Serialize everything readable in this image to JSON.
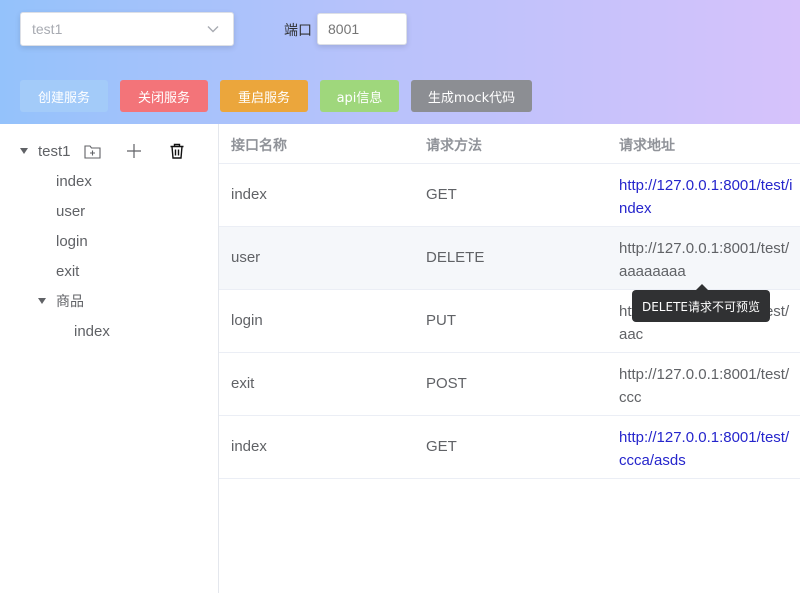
{
  "header": {
    "project_select": {
      "value": "test1",
      "icon": "chevron-down-icon"
    },
    "port_label": "端口",
    "port_input": {
      "placeholder": "8001",
      "value": ""
    },
    "buttons": {
      "create": "创建服务",
      "close": "关闭服务",
      "restart": "重启服务",
      "api_info": "api信息",
      "mock_code": "生成mock代码"
    },
    "colors": {
      "create": "#a3cbf9",
      "close": "#f37479",
      "restart": "#eba63c",
      "api_info": "#9fd77c",
      "mock_code": "#8c8e93"
    }
  },
  "sidebar": {
    "root": {
      "label": "test1",
      "icons": [
        "folder-add-icon",
        "plus-icon",
        "trash-icon"
      ]
    },
    "items": [
      "index",
      "user",
      "login",
      "exit"
    ],
    "group": {
      "label": "商品",
      "children": [
        "index"
      ]
    }
  },
  "table": {
    "headers": [
      "接口名称",
      "请求方法",
      "请求地址"
    ],
    "rows": [
      {
        "name": "index",
        "method": "GET",
        "url": "http://127.0.0.1:8001/test/index",
        "link": true
      },
      {
        "name": "user",
        "method": "DELETE",
        "url": "http://127.0.0.1:8001/test/aaaaaaaa",
        "link": false
      },
      {
        "name": "login",
        "method": "PUT",
        "url": "http://127.0.0.1:8001/test/aac",
        "link": false
      },
      {
        "name": "exit",
        "method": "POST",
        "url": "http://127.0.0.1:8001/test/ccc",
        "link": false
      },
      {
        "name": "index",
        "method": "GET",
        "url": "http://127.0.0.1:8001/test/ccca/asds",
        "link": true
      }
    ]
  },
  "tooltip": {
    "text": "DELETE请求不可预览"
  }
}
